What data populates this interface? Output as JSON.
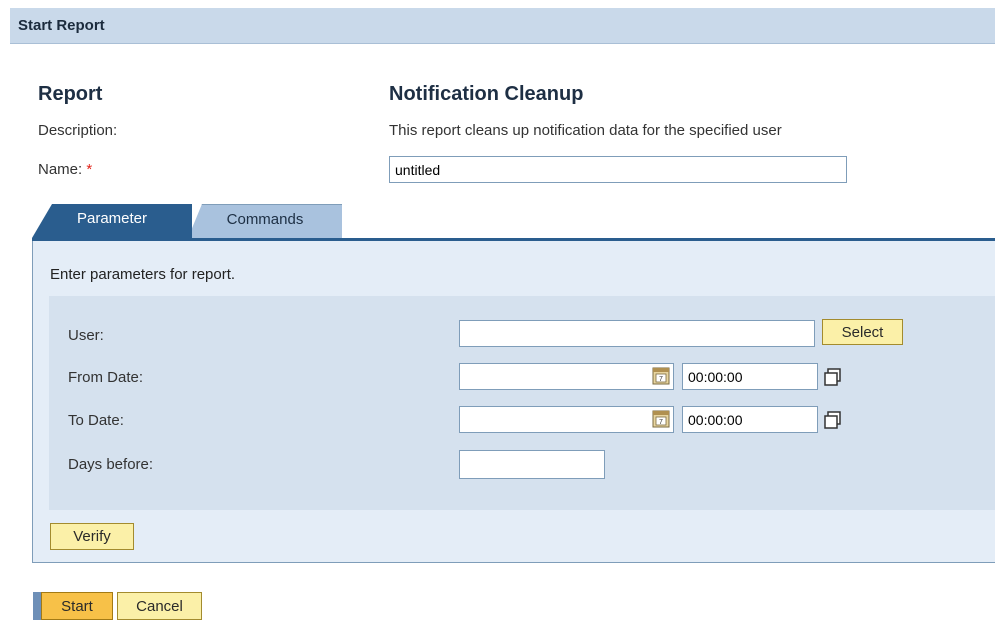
{
  "window": {
    "title": "Start Report"
  },
  "report": {
    "heading": "Report",
    "name_heading": "Notification Cleanup",
    "description_label": "Description:",
    "description": "This report cleans up notification data for the specified user",
    "name_label": "Name:",
    "required_marker": "*",
    "name_value": "untitled"
  },
  "tabs": [
    {
      "label": "Parameter",
      "active": true
    },
    {
      "label": "Commands",
      "active": false
    }
  ],
  "parameters": {
    "instruction": "Enter parameters for report.",
    "user_label": "User:",
    "user_value": "",
    "select_button": "Select",
    "from_date_label": "From Date:",
    "from_date_value": "",
    "from_time_value": "00:00:00",
    "to_date_label": "To Date:",
    "to_date_value": "",
    "to_time_value": "00:00:00",
    "days_before_label": "Days before:",
    "days_before_value": ""
  },
  "actions": {
    "verify": "Verify",
    "start": "Start",
    "cancel": "Cancel"
  },
  "icons": {
    "calendar": "calendar-icon",
    "time_picker": "time-picker-icon"
  },
  "colors": {
    "titlebar": "#c9d9ea",
    "active_tab": "#2a5d8e",
    "inactive_tab": "#a9c2de",
    "panel": "#e4edf7",
    "button": "#fbf0a8",
    "primary_button": "#f7c148",
    "required": "#e2231a"
  }
}
